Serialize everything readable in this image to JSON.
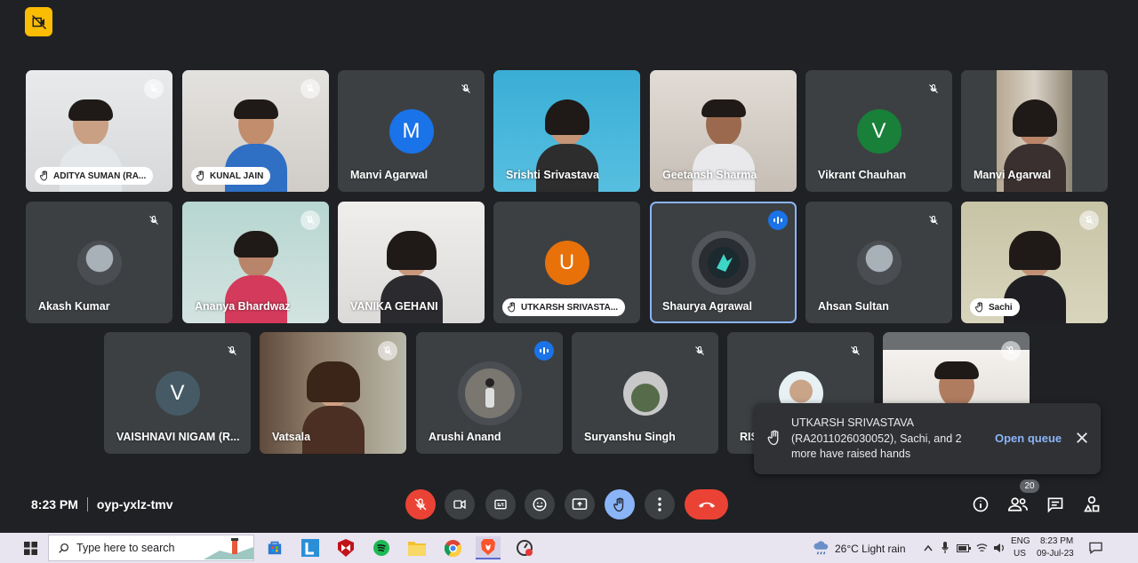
{
  "meeting": {
    "time": "8:23 PM",
    "code": "oyp-yxlz-tmv"
  },
  "participants": [
    {
      "name": "ADITYA SUMAN (RA...",
      "hand_raised": true,
      "video": true
    },
    {
      "name": "KUNAL JAIN",
      "hand_raised": true,
      "video": true
    },
    {
      "name": "Manvi Agarwal",
      "initial": "M",
      "avatar_color": "#1a73e8"
    },
    {
      "name": "Srishti Srivastava",
      "video": true
    },
    {
      "name": "Geetansh Sharma",
      "video": true
    },
    {
      "name": "Vikrant Chauhan",
      "initial": "V",
      "avatar_color": "#188038"
    },
    {
      "name": "Manvi Agarwal",
      "video": true
    },
    {
      "name": "Akash Kumar"
    },
    {
      "name": "Ananya Bhardwaz",
      "video": true
    },
    {
      "name": "VANIKA GEHANI",
      "video": true
    },
    {
      "name": "UTKARSH SRIVASTA...",
      "initial": "U",
      "avatar_color": "#e8710a",
      "hand_raised": true
    },
    {
      "name": "Shaurya Agrawal",
      "speaking": true,
      "active": true
    },
    {
      "name": "Ahsan Sultan"
    },
    {
      "name": "Sachi",
      "hand_raised": true,
      "video": true
    },
    {
      "name": "VAISHNAVI NIGAM (R...",
      "initial": "V",
      "avatar_color": "#455a64"
    },
    {
      "name": "Vatsala",
      "video": true
    },
    {
      "name": "Arushi Anand",
      "speaking": true
    },
    {
      "name": "Suryanshu Singh"
    },
    {
      "name": "RIS"
    },
    {
      "name": "",
      "video": true
    }
  ],
  "notification": {
    "message": "UTKARSH SRIVASTAVA (RA2011026030052), Sachi, and 2 more have raised hands",
    "action": "Open queue"
  },
  "people_count": "20",
  "taskbar": {
    "search_placeholder": "Type here to search",
    "weather": "26°C  Light rain",
    "lang_top": "ENG",
    "lang_bottom": "US",
    "clock_time": "8:23 PM",
    "clock_date": "09-Jul-23"
  },
  "colors": {
    "background": "#202124",
    "tile": "#3c4043",
    "accent_blue": "#8ab4f8",
    "end_call_red": "#ea4335",
    "warning_yellow": "#fbbc04"
  }
}
